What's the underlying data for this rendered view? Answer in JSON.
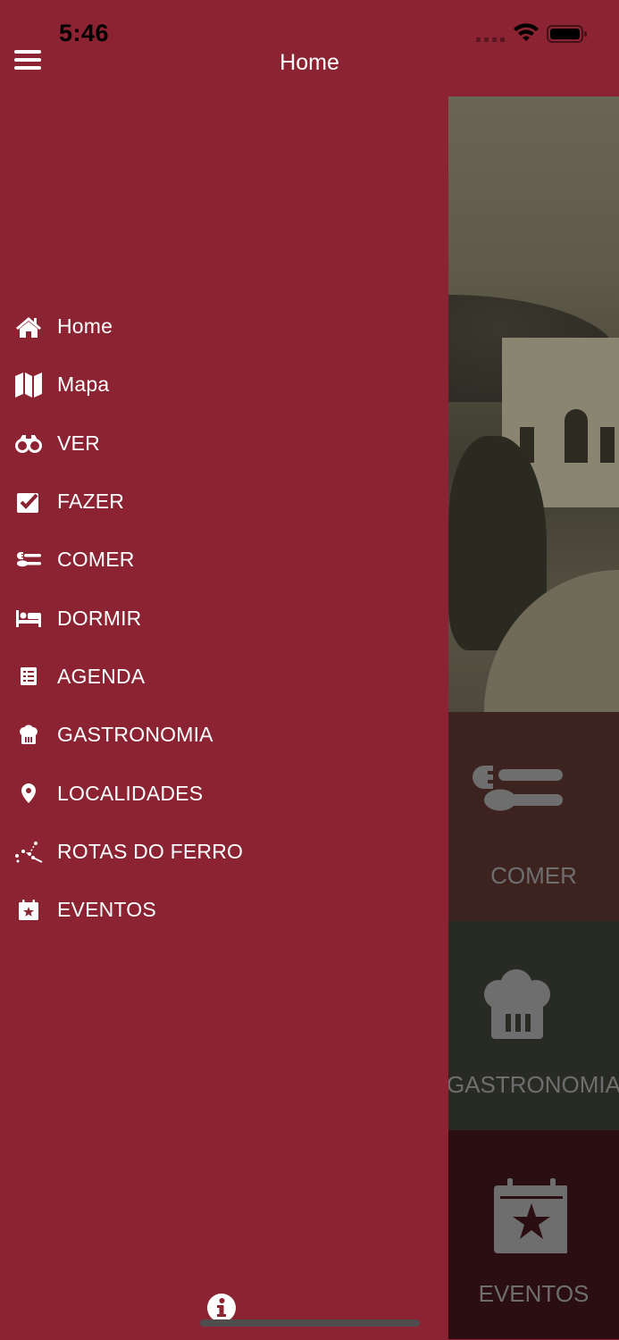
{
  "status_bar": {
    "time": "5:46"
  },
  "header": {
    "title": "Home",
    "menu_icon": "hamburger-icon"
  },
  "drawer": {
    "items": [
      {
        "label": "Home",
        "icon": "home-icon"
      },
      {
        "label": "Mapa",
        "icon": "map-icon"
      },
      {
        "label": "VER",
        "icon": "binoculars-icon"
      },
      {
        "label": "FAZER",
        "icon": "checkbox-icon"
      },
      {
        "label": "COMER",
        "icon": "cutlery-icon"
      },
      {
        "label": "DORMIR",
        "icon": "bed-icon"
      },
      {
        "label": "AGENDA",
        "icon": "list-icon"
      },
      {
        "label": "GASTRONOMIA",
        "icon": "chef-hat-icon"
      },
      {
        "label": "LOCALIDADES",
        "icon": "location-pin-icon"
      },
      {
        "label": "ROTAS DO FERRO",
        "icon": "route-icon"
      },
      {
        "label": "EVENTOS",
        "icon": "calendar-star-icon"
      }
    ],
    "info_icon": "info-icon"
  },
  "content": {
    "tiles": [
      {
        "label": "COMER",
        "icon": "cutlery-icon"
      },
      {
        "label": "GASTRONOMIA",
        "icon": "chef-hat-icon"
      },
      {
        "label": "EVENTOS",
        "icon": "calendar-star-icon"
      }
    ]
  },
  "colors": {
    "primary": "#8b2332",
    "text": "#ffffff",
    "tile_label": "#6e6e6e"
  }
}
